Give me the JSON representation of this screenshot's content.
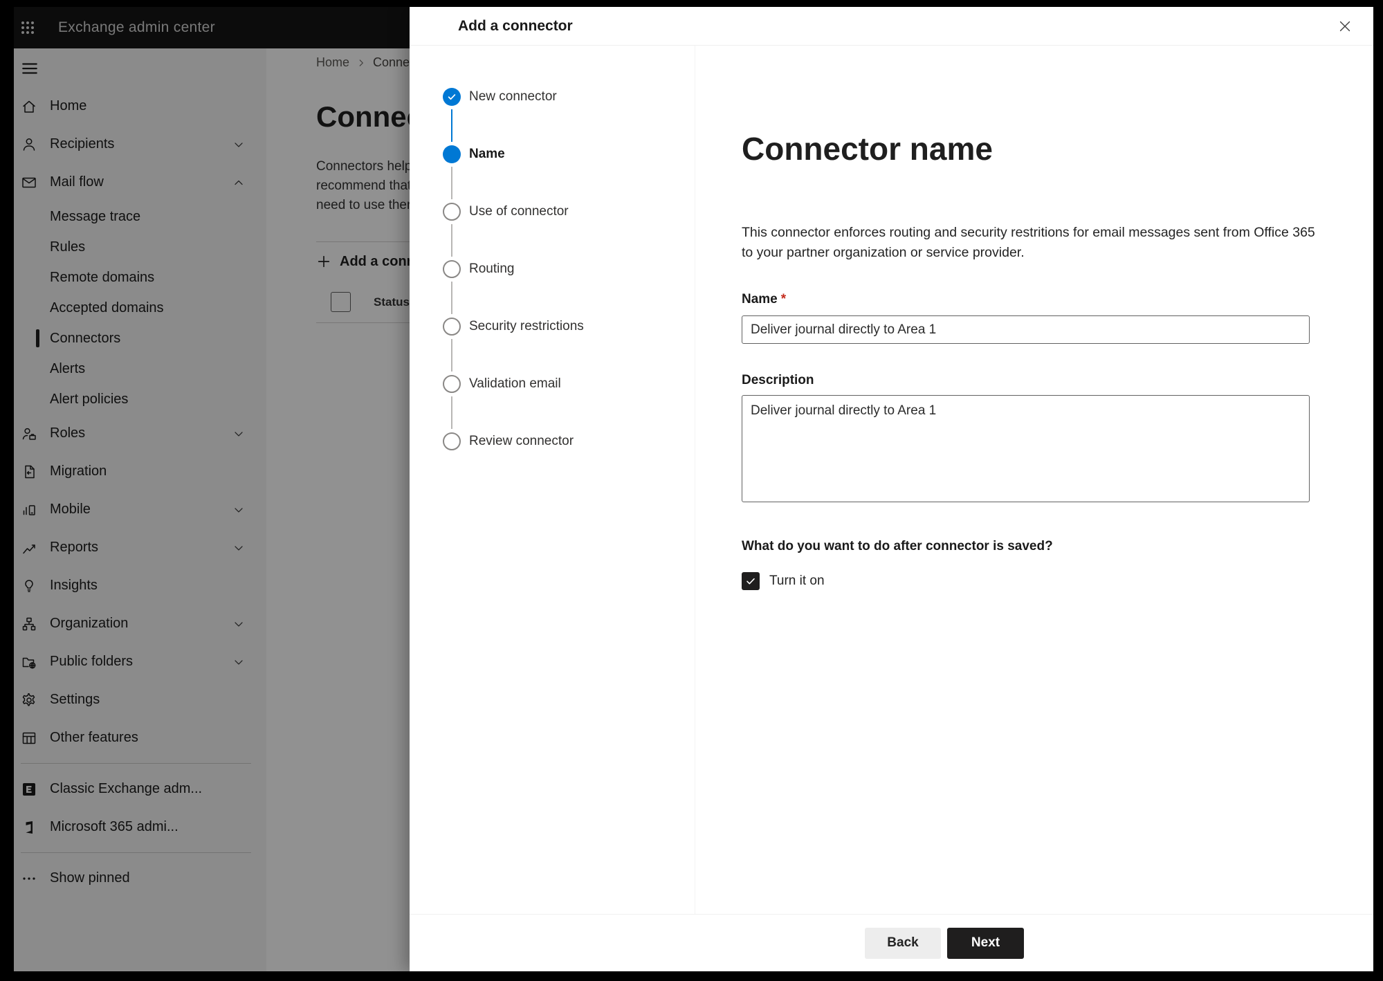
{
  "app": {
    "title": "Exchange admin center"
  },
  "colors": {
    "accent": "#0078d4",
    "primary_button": "#1f1e1e",
    "required_asterisk": "#c42b1c",
    "topbar": "#161616"
  },
  "sidebar": {
    "items": [
      {
        "label": "Home",
        "icon": "home-icon"
      },
      {
        "label": "Recipients",
        "icon": "person-icon",
        "chevron": "down"
      },
      {
        "label": "Mail flow",
        "icon": "mail-icon",
        "chevron": "up"
      },
      {
        "label": "Message trace",
        "sub": true
      },
      {
        "label": "Rules",
        "sub": true
      },
      {
        "label": "Remote domains",
        "sub": true
      },
      {
        "label": "Accepted domains",
        "sub": true
      },
      {
        "label": "Connectors",
        "sub": true,
        "selected": true
      },
      {
        "label": "Alerts",
        "sub": true
      },
      {
        "label": "Alert policies",
        "sub": true
      },
      {
        "label": "Roles",
        "icon": "roles-icon",
        "chevron": "down"
      },
      {
        "label": "Migration",
        "icon": "migration-icon"
      },
      {
        "label": "Mobile",
        "icon": "mobile-icon",
        "chevron": "down"
      },
      {
        "label": "Reports",
        "icon": "reports-icon",
        "chevron": "down"
      },
      {
        "label": "Insights",
        "icon": "insights-icon"
      },
      {
        "label": "Organization",
        "icon": "organization-icon",
        "chevron": "down"
      },
      {
        "label": "Public folders",
        "icon": "public-folders-icon",
        "chevron": "down"
      },
      {
        "label": "Settings",
        "icon": "settings-icon"
      },
      {
        "label": "Other features",
        "icon": "other-features-icon"
      }
    ],
    "footer_items": [
      {
        "label": "Classic Exchange adm...",
        "icon": "classic-exchange-icon"
      },
      {
        "label": "Microsoft 365 admi...",
        "icon": "microsoft-365-icon"
      },
      {
        "label": "Show pinned",
        "icon": "more-icon"
      }
    ]
  },
  "page": {
    "breadcrumb": {
      "home": "Home",
      "current": "Conne"
    },
    "title": "Connect",
    "intro_lines": [
      "Connectors help",
      "recommend that",
      "need to use ther"
    ],
    "add_button_label": "Add a conn",
    "status_header": "Status"
  },
  "dialog": {
    "title": "Add a connector",
    "steps": [
      {
        "label": "New connector",
        "state": "completed"
      },
      {
        "label": "Name",
        "state": "active"
      },
      {
        "label": "Use of connector",
        "state": "pending"
      },
      {
        "label": "Routing",
        "state": "pending"
      },
      {
        "label": "Security restrictions",
        "state": "pending"
      },
      {
        "label": "Validation email",
        "state": "pending"
      },
      {
        "label": "Review connector",
        "state": "pending"
      }
    ],
    "content": {
      "heading": "Connector name",
      "description": "This connector enforces routing and security restritions for email messages sent from Office 365 to your partner organization or service provider.",
      "name_label": "Name",
      "required_marker": "*",
      "name_value": "Deliver journal directly to Area 1",
      "description_label": "Description",
      "description_value": "Deliver journal directly to Area 1",
      "after_save_question": "What do you want to do after connector is saved?",
      "turn_on_label": "Turn it on",
      "turn_on_checked": true
    },
    "footer": {
      "back_label": "Back",
      "next_label": "Next"
    }
  }
}
